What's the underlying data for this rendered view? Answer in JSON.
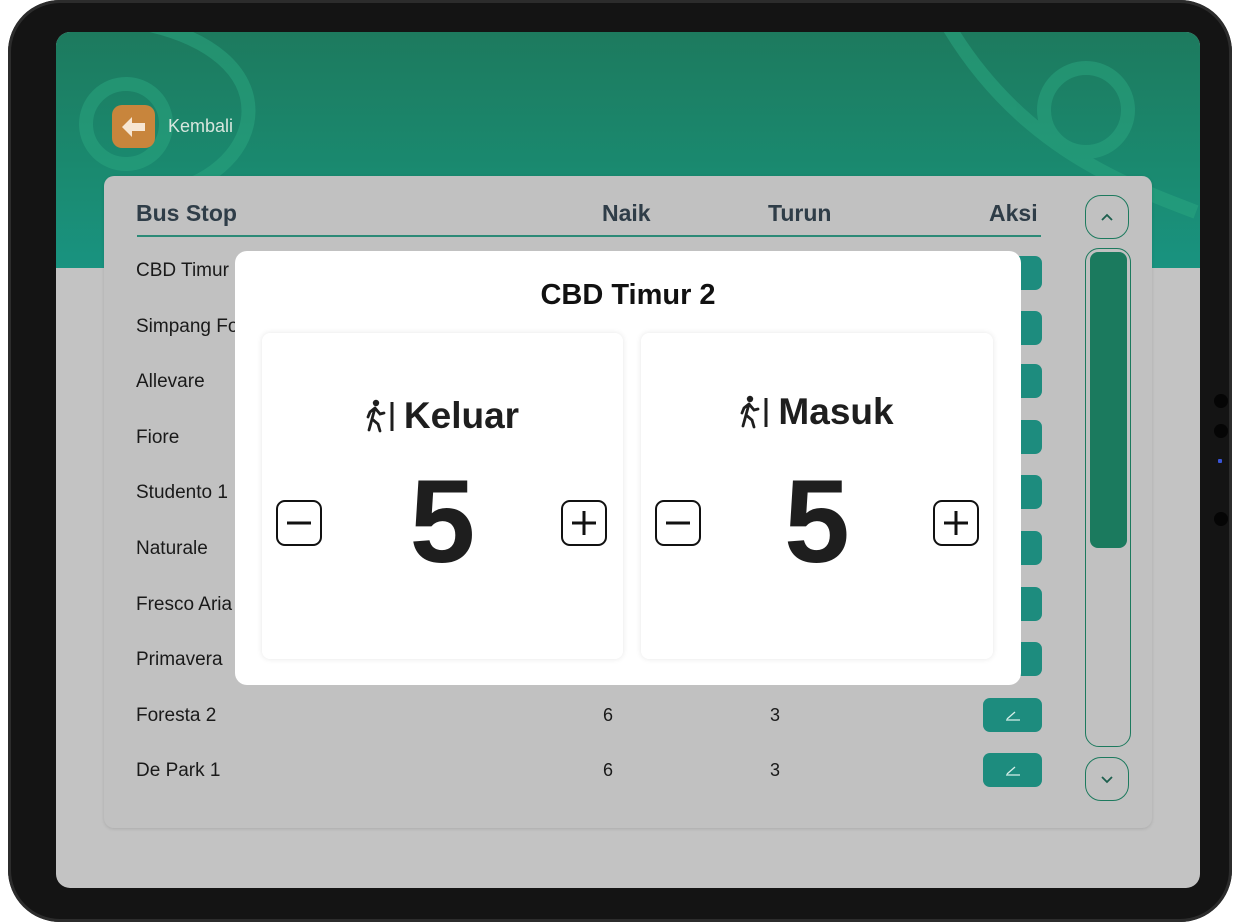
{
  "header": {
    "back_label": "Kembali"
  },
  "table": {
    "columns": {
      "bus_stop": "Bus Stop",
      "naik": "Naik",
      "turun": "Turun",
      "aksi": "Aksi"
    },
    "rows": [
      {
        "name": "CBD Timur 2",
        "naik": "",
        "turun": ""
      },
      {
        "name": "Simpang Foresta",
        "naik": "",
        "turun": ""
      },
      {
        "name": "Allevare",
        "naik": "",
        "turun": ""
      },
      {
        "name": "Fiore",
        "naik": "",
        "turun": ""
      },
      {
        "name": "Studento 1",
        "naik": "",
        "turun": ""
      },
      {
        "name": "Naturale",
        "naik": "",
        "turun": ""
      },
      {
        "name": "Fresco Aria",
        "naik": "",
        "turun": ""
      },
      {
        "name": "Primavera",
        "naik": "",
        "turun": ""
      },
      {
        "name": "Foresta 2",
        "naik": "6",
        "turun": "3"
      },
      {
        "name": "De Park 1",
        "naik": "6",
        "turun": "3"
      }
    ]
  },
  "modal": {
    "title": "CBD Timur 2",
    "keluar": {
      "label": "Keluar",
      "value": "5"
    },
    "masuk": {
      "label": "Masuk",
      "value": "5"
    }
  },
  "icons": {
    "back": "arrow-left-icon",
    "edit": "edit-icon",
    "scroll_up": "chevron-up-icon",
    "scroll_down": "chevron-down-icon",
    "pedestrian": "pedestrian-icon",
    "minus": "minus-icon",
    "plus": "plus-icon"
  },
  "colors": {
    "primary": "#1d7a5e",
    "accent": "#1d8c7e",
    "back_button": "#c8853c",
    "text_dark": "#1e1e1e"
  }
}
